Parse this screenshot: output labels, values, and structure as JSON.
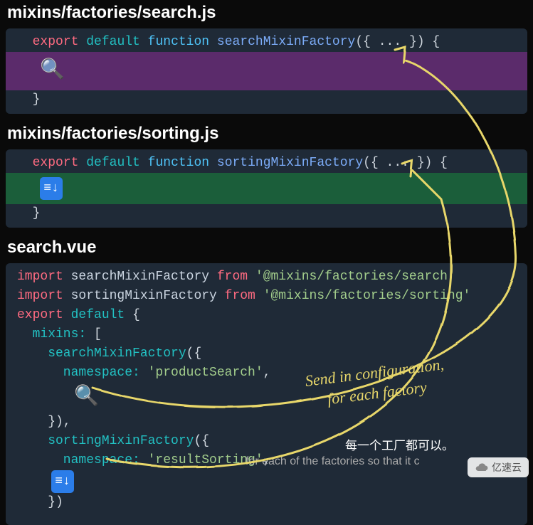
{
  "files": {
    "search_factory": {
      "path": "mixins/factories/search.js"
    },
    "sorting_factory": {
      "path": "mixins/factories/sorting.js"
    },
    "search_vue": {
      "path": "search.vue"
    }
  },
  "code": {
    "search_factory": {
      "export": "export",
      "default": "default",
      "function": "function",
      "name": "searchMixinFactory",
      "params": "({ ... }) {",
      "close": "}"
    },
    "sorting_factory": {
      "export": "export",
      "default": "default",
      "function": "function",
      "name": "sortingMixinFactory",
      "params": "({ ... }) {",
      "close": "}"
    },
    "search_vue": {
      "line1_import": "import",
      "line1_ident": " searchMixinFactory ",
      "line1_from": "from",
      "line1_path": "'@mixins/factories/search'",
      "line2_import": "import",
      "line2_ident": " sortingMixinFactory ",
      "line2_from": "from",
      "line2_path": "'@mixins/factories/sorting'",
      "blank": "",
      "line3_export": "export",
      "line3_default": "default",
      "line3_brace": " {",
      "line4_mixins": "  mixins:",
      "line4_bracket": " [",
      "line5_call": "    searchMixinFactory",
      "line5_open": "({",
      "line6_ns": "      namespace:",
      "line6_val": " 'productSearch'",
      "line6_comma": ",",
      "line7_close": "    }),",
      "line8_call": "    sortingMixinFactory",
      "line8_open": "({",
      "line9_ns": "      namespace:",
      "line9_val": " 'resultSorting'",
      "line9_comma": ",",
      "line10_close": "    })"
    }
  },
  "annotations": {
    "handwritten": "Send in configuration,\nfor each factory",
    "chinese": "每一个工厂都可以。",
    "subtitle": "for each of the factories so that it c"
  },
  "watermark": "亿速云"
}
